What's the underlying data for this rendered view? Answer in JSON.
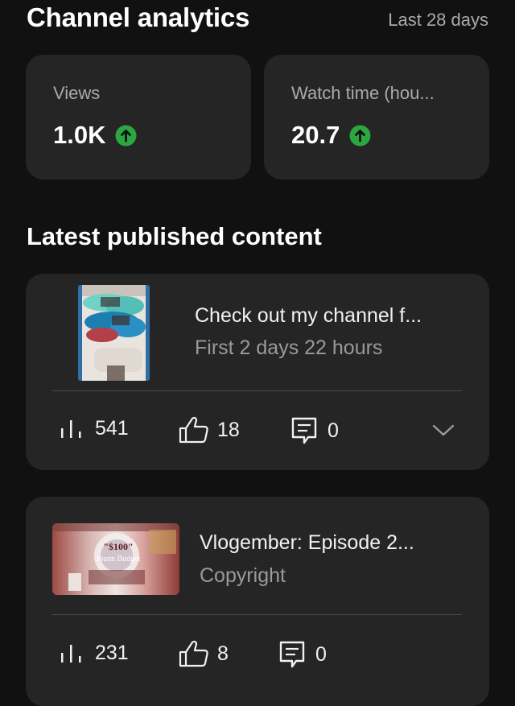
{
  "header": {
    "title": "Channel analytics",
    "period": "Last 28 days"
  },
  "stats": [
    {
      "label": "Views",
      "value": "1.0K",
      "trend": "up"
    },
    {
      "label": "Watch time (hou...",
      "value": "20.7",
      "trend": "up"
    }
  ],
  "section_title": "Latest published content",
  "content": [
    {
      "title": "Check out my channel f...",
      "subtitle": "First 2 days 22 hours",
      "views": "541",
      "likes": "18",
      "comments": "0"
    },
    {
      "title": "Vlogember: Episode 2...",
      "subtitle": "Copyright",
      "thumbnail_text": {
        "price": "\"$100\"",
        "line2": "Joann Budget"
      },
      "views": "231",
      "likes": "8",
      "comments": "0"
    }
  ],
  "colors": {
    "background": "#111111",
    "card": "#252525",
    "trend_up": "#2ba640",
    "secondary_text": "#aaaaaa"
  },
  "icons": {
    "trend": "arrow-up-circle-icon",
    "views": "bar-chart-icon",
    "likes": "thumbs-up-icon",
    "comments": "comment-icon",
    "expand": "chevron-down-icon"
  }
}
